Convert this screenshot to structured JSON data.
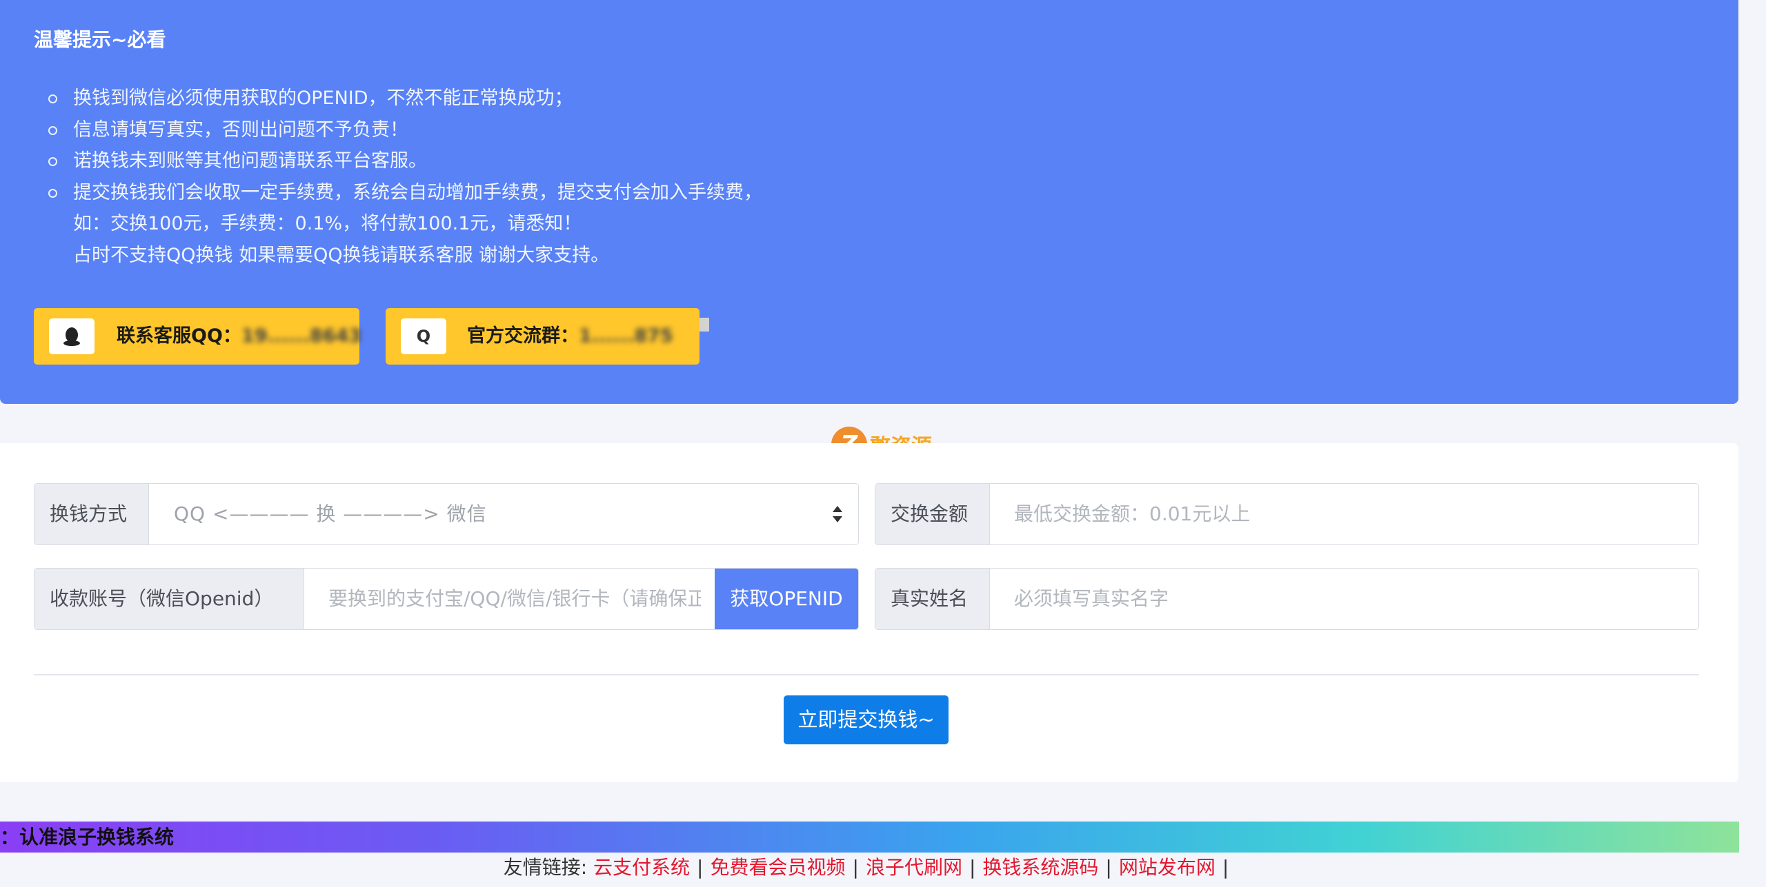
{
  "notice": {
    "title": "温馨提示~必看",
    "items": [
      {
        "lines": [
          "换钱到微信必须使用获取的OPENID，不然不能正常换成功；"
        ]
      },
      {
        "lines": [
          "信息请填写真实，否则出问题不予负责！"
        ]
      },
      {
        "lines": [
          "诺换钱未到账等其他问题请联系平台客服。"
        ]
      },
      {
        "lines": [
          "提交换钱我们会收取一定手续费，系统会自动增加手续费，提交支付会加入手续费，",
          "如：交换100元，手续费：0.1%，将付款100.1元，请悉知！",
          "占时不支持QQ换钱 如果需要QQ换钱请联系客服 谢谢大家支持。"
        ]
      }
    ],
    "contact_service": {
      "label": "联系客服QQ：",
      "value": "19......8643",
      "icon": "qq-penguin-icon"
    },
    "official_group": {
      "label": "官方交流群：",
      "value": "1......875",
      "icon": "q-icon",
      "icon_glyph": "Q"
    }
  },
  "watermark": {
    "logo_glyph": "Z",
    "text": "憨资源"
  },
  "form": {
    "exchange_method": {
      "label": "换钱方式",
      "selected": "QQ   <———— 换 ————>   微信"
    },
    "amount": {
      "label": "交换金额",
      "placeholder": "最低交换金额：0.01元以上"
    },
    "account": {
      "label": "收款账号（微信Openid）",
      "placeholder": "要换到的支付宝/QQ/微信/银行卡（请确保正确）",
      "button": "获取OPENID"
    },
    "real_name": {
      "label": "真实姓名",
      "placeholder": "必须填写真实名字"
    },
    "submit": "立即提交换钱~"
  },
  "marquee": {
    "text": "：认准浪子换钱系统"
  },
  "footer": {
    "label": "友情链接:",
    "links": [
      "云支付系统",
      "免费看会员视频",
      "浪子代刷网",
      "换钱系统源码",
      "网站发布网"
    ]
  },
  "colors": {
    "notice_bg": "#5882f6",
    "contact_btn": "#ffc72c",
    "submit_btn": "#0f7de8",
    "link": "#e3172d"
  }
}
